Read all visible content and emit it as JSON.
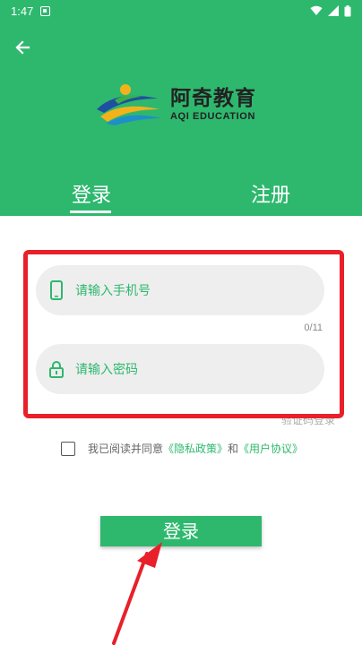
{
  "status_bar": {
    "time": "1:47"
  },
  "header": {
    "logo": {
      "name_cn": "阿奇教育",
      "name_en": "AQI EDUCATION"
    }
  },
  "tabs": [
    {
      "label": "登录",
      "active": true
    },
    {
      "label": "注册",
      "active": false
    }
  ],
  "form": {
    "phone_placeholder": "请输入手机号",
    "phone_counter": "0/11",
    "password_placeholder": "请输入密码",
    "code_login_link": "验证码登录"
  },
  "agreement": {
    "prefix": "我已阅读并同意",
    "privacy_link": "《隐私政策》",
    "and_text": "和",
    "user_link": "《用户协议》"
  },
  "login_button": {
    "label": "登录"
  },
  "colors": {
    "brand_green": "#2eb86e",
    "highlight_red": "#e8202a"
  },
  "icons": [
    "image-icon",
    "wifi-icon",
    "signal-icon",
    "battery-icon",
    "back-arrow-icon",
    "phone-icon",
    "lock-icon"
  ]
}
